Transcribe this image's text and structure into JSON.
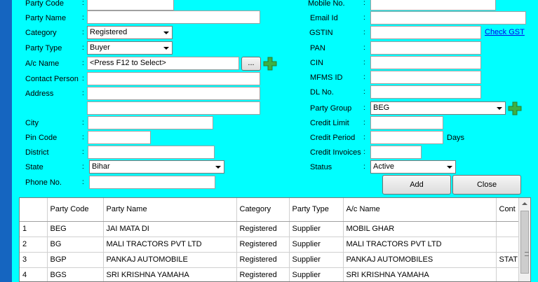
{
  "left": {
    "party_code": {
      "label": "Party Code",
      "value": ""
    },
    "party_name": {
      "label": "Party Name",
      "value": ""
    },
    "category": {
      "label": "Category",
      "value": "Registered"
    },
    "party_type": {
      "label": "Party Type",
      "value": "Buyer"
    },
    "ac_name": {
      "label": "A/c Name",
      "value": "<Press F12 to Select>",
      "browse_label": "..."
    },
    "contact_person": {
      "label": "Contact Person",
      "value": ""
    },
    "address": {
      "label": "Address",
      "line1": "",
      "line2": ""
    },
    "city": {
      "label": "City",
      "value": ""
    },
    "pin_code": {
      "label": "Pin Code",
      "value": ""
    },
    "district": {
      "label": "District",
      "value": ""
    },
    "state": {
      "label": "State",
      "value": "Bihar"
    },
    "phone_no": {
      "label": "Phone No.",
      "value": ""
    }
  },
  "right": {
    "mobile_no": {
      "label": "Mobile No.",
      "value": ""
    },
    "email_id": {
      "label": "Email Id",
      "value": ""
    },
    "gstin": {
      "label": "GSTIN",
      "value": "",
      "check_link": "Check GST"
    },
    "pan": {
      "label": "PAN",
      "value": ""
    },
    "cin": {
      "label": "CIN",
      "value": ""
    },
    "mfms_id": {
      "label": "MFMS ID",
      "value": ""
    },
    "dl_no": {
      "label": "DL No.",
      "value": ""
    },
    "party_group": {
      "label": "Party Group",
      "value": "BEG"
    },
    "credit_limit": {
      "label": "Credit Limit",
      "value": ""
    },
    "credit_period": {
      "label": "Credit Period",
      "value": "",
      "unit": "Days"
    },
    "credit_invoices": {
      "label": "Credit Invoices",
      "value": ""
    },
    "status": {
      "label": "Status",
      "value": "Active"
    }
  },
  "colon": ":",
  "buttons": {
    "add": "Add",
    "close": "Close"
  },
  "grid": {
    "headers": [
      "",
      "Party Code",
      "Party Name",
      "Category",
      "Party Type",
      "A/c Name",
      "Cont"
    ],
    "rows": [
      [
        "1",
        "BEG",
        "JAI MATA DI",
        "Registered",
        "Supplier",
        "MOBIL GHAR",
        ""
      ],
      [
        "2",
        "BG",
        "MALI TRACTORS PVT  LTD",
        "Registered",
        "Supplier",
        "MALI TRACTORS PVT LTD",
        ""
      ],
      [
        "3",
        "BGP",
        "PANKAJ AUTOMOBILE",
        "Registered",
        "Supplier",
        "PANKAJ AUTOMOBILES",
        "STAT"
      ],
      [
        "4",
        "BGS",
        "SRI KRISHNA YAMAHA",
        "Registered",
        "Supplier",
        "SRI KRISHNA YAMAHA",
        ""
      ]
    ]
  },
  "colors": {
    "form_bg": "#00ffff",
    "window_border": "#1565c0",
    "plus_green": "#3cb043"
  }
}
